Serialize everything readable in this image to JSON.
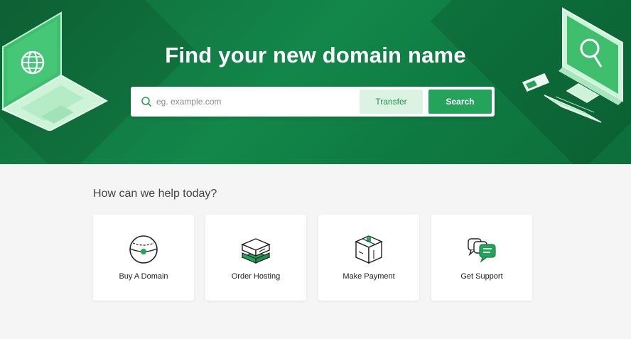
{
  "hero": {
    "title": "Find your new domain name",
    "search": {
      "placeholder": "eg. example.com",
      "value": "",
      "transfer_label": "Transfer",
      "search_label": "Search"
    }
  },
  "help": {
    "title": "How can we help today?",
    "cards": [
      {
        "label": "Buy A Domain",
        "icon": "globe-icon"
      },
      {
        "label": "Order Hosting",
        "icon": "server-box-icon"
      },
      {
        "label": "Make Payment",
        "icon": "payment-package-icon"
      },
      {
        "label": "Get Support",
        "icon": "chat-bubbles-icon"
      }
    ]
  },
  "colors": {
    "brand_green": "#13874a",
    "button_green": "#23a45a",
    "transfer_bg": "#dcf2e3",
    "page_bg": "#f5f5f5"
  }
}
